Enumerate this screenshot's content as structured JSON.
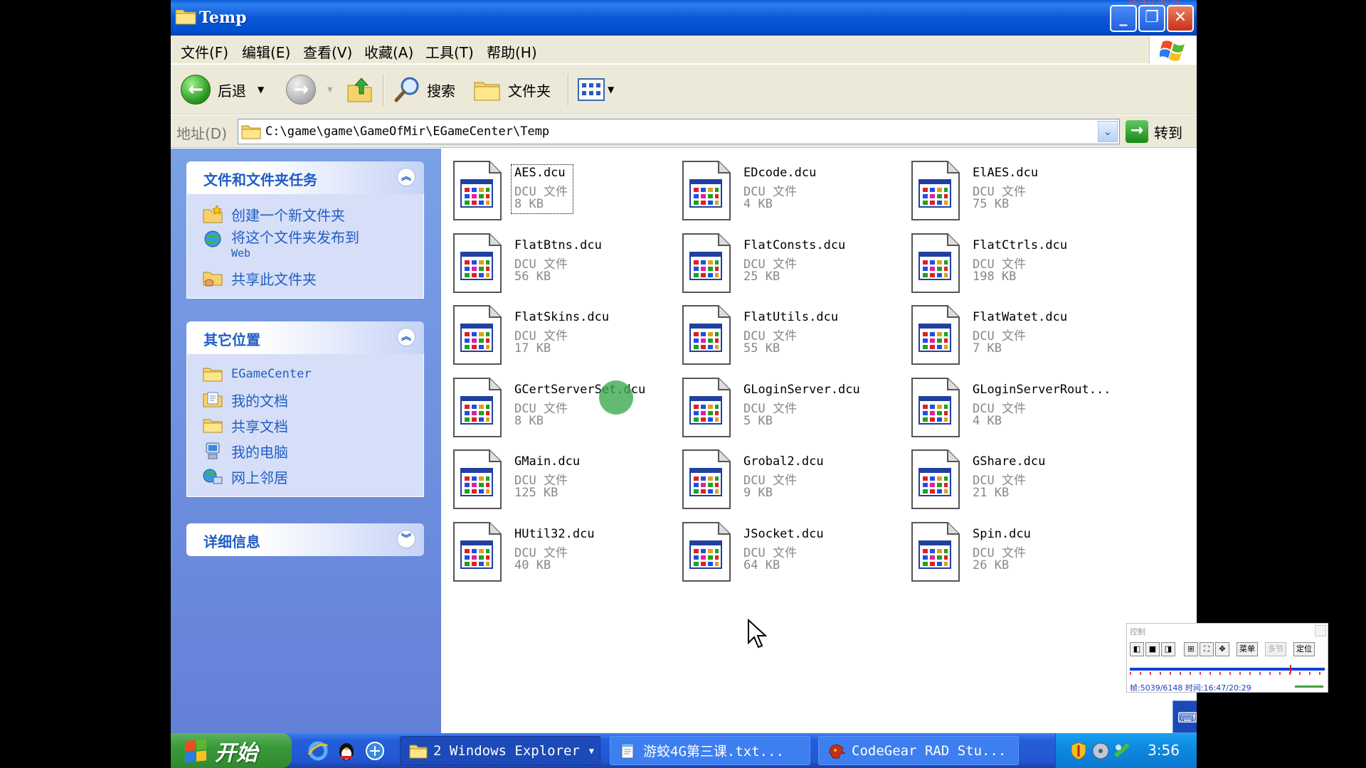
{
  "window": {
    "title": "Temp",
    "overlay_time": "16:47/20:29"
  },
  "menu": [
    "文件(F)",
    "编辑(E)",
    "查看(V)",
    "收藏(A)",
    "工具(T)",
    "帮助(H)"
  ],
  "toolbar": {
    "back_label": "后退",
    "search_label": "搜索",
    "folders_label": "文件夹"
  },
  "address": {
    "label": "地址(D)",
    "path": "C:\\game\\game\\GameOfMir\\EGameCenter\\Temp",
    "go_label": "转到"
  },
  "tasks_panel": {
    "title": "文件和文件夹任务",
    "items": [
      "创建一个新文件夹",
      "将这个文件夹发布到",
      "Web",
      "共享此文件夹"
    ]
  },
  "places_panel": {
    "title": "其它位置",
    "items": [
      "EGameCenter",
      "我的文档",
      "共享文档",
      "我的电脑",
      "网上邻居"
    ]
  },
  "details_panel": {
    "title": "详细信息"
  },
  "files": [
    {
      "name": "AES.dcu",
      "type": "DCU 文件",
      "size": "8 KB"
    },
    {
      "name": "EDcode.dcu",
      "type": "DCU 文件",
      "size": "4 KB"
    },
    {
      "name": "ElAES.dcu",
      "type": "DCU 文件",
      "size": "75 KB"
    },
    {
      "name": "FlatBtns.dcu",
      "type": "DCU 文件",
      "size": "56 KB"
    },
    {
      "name": "FlatConsts.dcu",
      "type": "DCU 文件",
      "size": "25 KB"
    },
    {
      "name": "FlatCtrls.dcu",
      "type": "DCU 文件",
      "size": "198 KB"
    },
    {
      "name": "FlatSkins.dcu",
      "type": "DCU 文件",
      "size": "17 KB"
    },
    {
      "name": "FlatUtils.dcu",
      "type": "DCU 文件",
      "size": "55 KB"
    },
    {
      "name": "FlatWatet.dcu",
      "type": "DCU 文件",
      "size": "7 KB"
    },
    {
      "name": "GCertServerSet.dcu",
      "type": "DCU 文件",
      "size": "8 KB"
    },
    {
      "name": "GLoginServer.dcu",
      "type": "DCU 文件",
      "size": "5 KB"
    },
    {
      "name": "GLoginServerRout...",
      "type": "DCU 文件",
      "size": "4 KB"
    },
    {
      "name": "GMain.dcu",
      "type": "DCU 文件",
      "size": "125 KB"
    },
    {
      "name": "Grobal2.dcu",
      "type": "DCU 文件",
      "size": "9 KB"
    },
    {
      "name": "GShare.dcu",
      "type": "DCU 文件",
      "size": "21 KB"
    },
    {
      "name": "HUtil32.dcu",
      "type": "DCU 文件",
      "size": "40 KB"
    },
    {
      "name": "JSocket.dcu",
      "type": "DCU 文件",
      "size": "64 KB"
    },
    {
      "name": "Spin.dcu",
      "type": "DCU 文件",
      "size": "26 KB"
    }
  ],
  "taskbar": {
    "start_label": "开始",
    "tasks": [
      "2 Windows Explorer",
      "游蛟4G第三课.txt...",
      "CodeGear RAD Stu..."
    ],
    "clock": "3:56"
  },
  "player": {
    "title": "控制",
    "buttons": [
      "菜单",
      "多节",
      "定位"
    ],
    "status": "帧:5039/6148 时间:16:47/20:29",
    "progress": 0.82
  },
  "colors": {
    "titlebar": "#0a58d8",
    "leftpane": "#7aa1e6",
    "link": "#215dc6",
    "taskbar": "#245edb"
  }
}
